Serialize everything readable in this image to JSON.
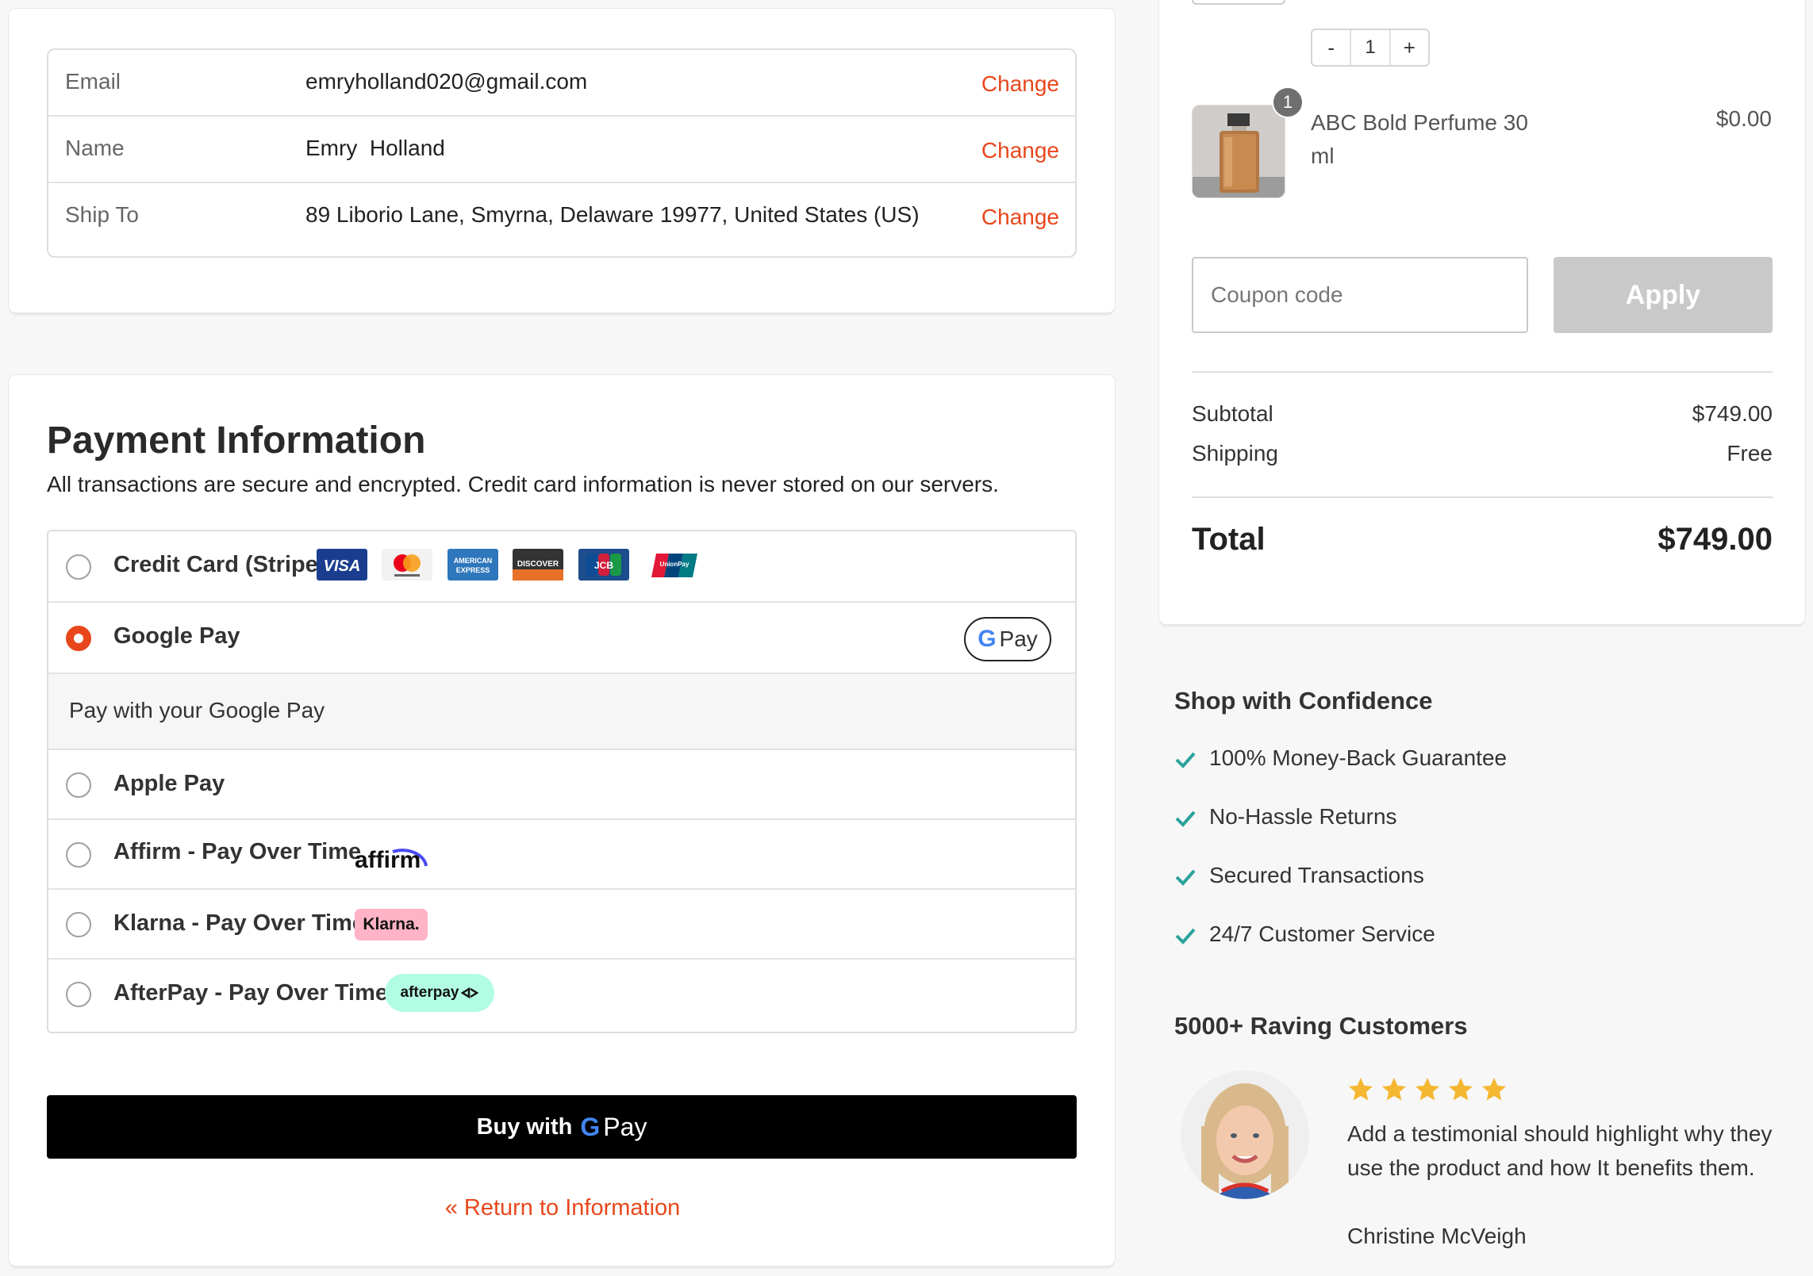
{
  "contact": {
    "rows": [
      {
        "label": "Email",
        "value": "emryholland020@gmail.com",
        "action": "Change"
      },
      {
        "label": "Name",
        "value": "Emry  Holland",
        "action": "Change"
      },
      {
        "label": "Ship To",
        "value": "89 Liborio Lane, Smyrna, Delaware 19977, United States (US)",
        "action": "Change"
      }
    ]
  },
  "payment": {
    "title": "Payment Information",
    "subtitle": "All transactions are secure and encrypted. Credit card information is never stored on our servers.",
    "methods": [
      {
        "label": "Credit Card (Stripe)",
        "selected": false,
        "logos": [
          "visa",
          "mastercard",
          "american-express",
          "discover",
          "jcb",
          "unionpay"
        ]
      },
      {
        "label": "Google Pay",
        "selected": true,
        "badge": "Pay",
        "info": "Pay with your Google Pay"
      },
      {
        "label": "Apple Pay",
        "selected": false
      },
      {
        "label": "Affirm - Pay Over Time",
        "selected": false,
        "badge": "affirm"
      },
      {
        "label": "Klarna - Pay Over Time",
        "selected": false,
        "badge": "Klarna."
      },
      {
        "label": "AfterPay - Pay Over Time",
        "selected": false,
        "badge": "afterpay"
      }
    ],
    "card_logo_text": {
      "visa": "VISA",
      "amex": "AMERICAN EXPRESS",
      "discover": "DISCOVER",
      "jcb": "JCB",
      "unionpay": "UnionPay"
    },
    "buy_button": {
      "prefix": "Buy with",
      "suffix": "Pay"
    },
    "return_link": "« Return to Information"
  },
  "summary": {
    "stepper": {
      "minus": "-",
      "qty": "1",
      "plus": "+"
    },
    "product": {
      "name": "ABC Bold Perfume 30 ml",
      "price": "$0.00",
      "qty_badge": "1"
    },
    "coupon": {
      "placeholder": "Coupon code",
      "apply_label": "Apply"
    },
    "subtotal": {
      "label": "Subtotal",
      "value": "$749.00"
    },
    "shipping": {
      "label": "Shipping",
      "value": "Free"
    },
    "total": {
      "label": "Total",
      "value": "$749.00"
    }
  },
  "confidence": {
    "title": "Shop with Confidence",
    "items": [
      "100% Money-Back Guarantee",
      "No-Hassle Returns",
      "Secured Transactions",
      "24/7 Customer Service"
    ],
    "check_color": "#2aa39b"
  },
  "reviews": {
    "title": "5000+ Raving Customers",
    "rating": 5,
    "star_color": "#f5b731",
    "text": "Add a testimonial should highlight why they use the product and how It benefits them.",
    "author": "Christine McVeigh"
  },
  "colors": {
    "accent": "#e8471c",
    "button_dark": "#000000",
    "apply_disabled": "#c9c9c9"
  }
}
